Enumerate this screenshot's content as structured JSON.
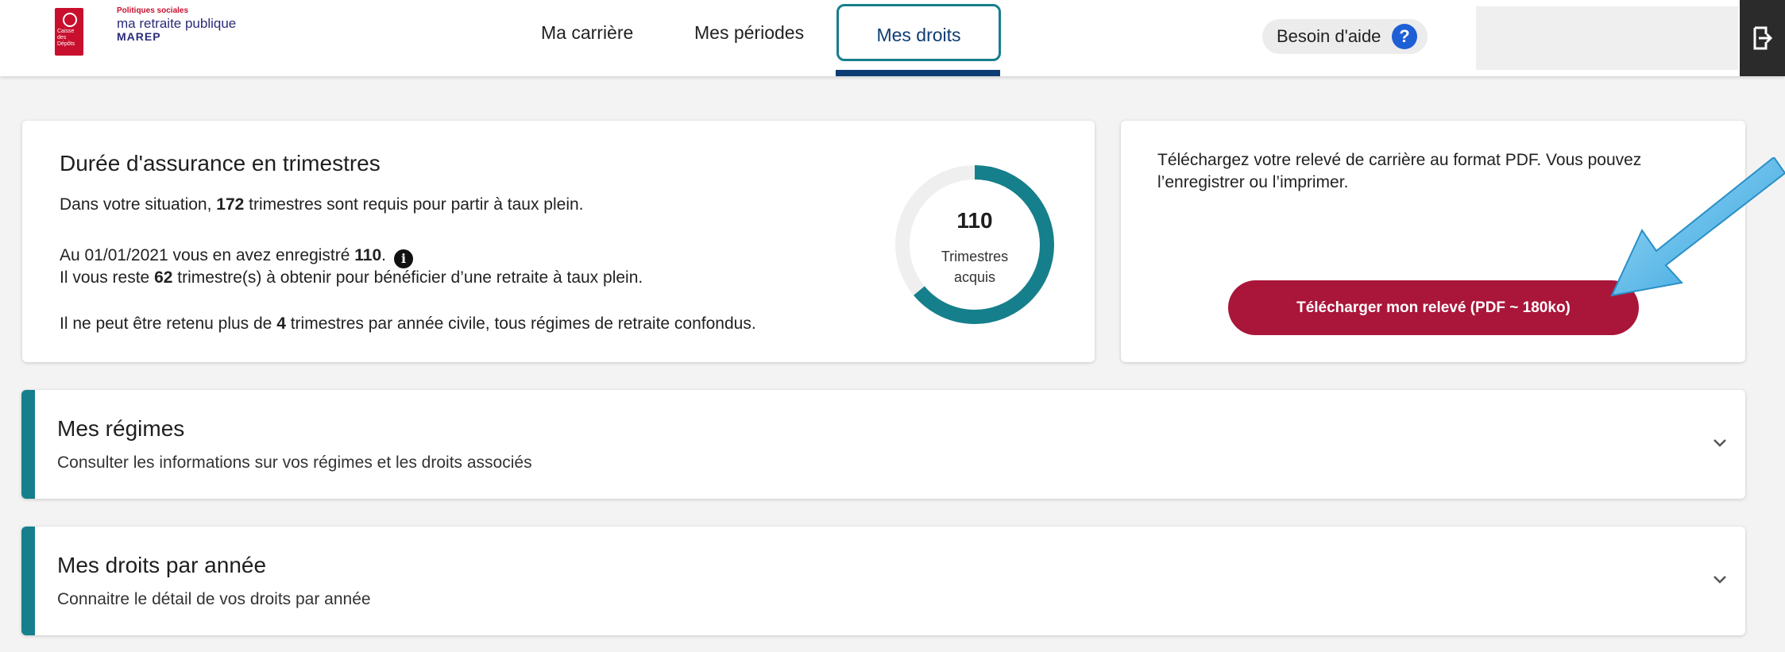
{
  "header": {
    "brand": {
      "badge_text": "Caisse des Dépôts",
      "kicker": "Politiques sociales",
      "name": "ma retraite publique",
      "product": "MAREP"
    },
    "nav": [
      {
        "label": "Ma carrière"
      },
      {
        "label": "Mes périodes"
      },
      {
        "label": "Mes droits",
        "active": true
      }
    ],
    "help_label": "Besoin d'aide",
    "help_icon": "?"
  },
  "insurance_card": {
    "title": "Durée d'assurance en trimestres",
    "line1_pre": "Dans votre situation, ",
    "line1_num": "172",
    "line1_post": " trimestres sont requis pour partir à taux plein.",
    "line2_pre": "Au 01/01/2021 vous en avez enregistré ",
    "line2_num": "110",
    "line2_post": ".",
    "line3_pre": "Il vous reste ",
    "line3_num": "62",
    "line3_post": " trimestre(s) à obtenir pour bénéficier d’une retraite à taux plein.",
    "line4_pre": "Il ne peut être retenu plus de ",
    "line4_num": "4",
    "line4_post": " trimestres par année civile, tous régimes de retraite confondus.",
    "gauge": {
      "value": "110",
      "label_line1": "Trimestres",
      "label_line2": "acquis",
      "acquired": 110,
      "required": 172,
      "color": "#167f8c",
      "track_color": "#efefef"
    }
  },
  "download_card": {
    "text_line1": "Téléchargez votre relevé de carrière au format PDF. Vous pouvez",
    "text_line2": "l’enregistrer ou l’imprimer.",
    "button_label": "Télécharger mon relevé (PDF ~ 180ko)"
  },
  "accordions": [
    {
      "title": "Mes régimes",
      "subtitle": "Consulter les informations sur vos régimes et les droits associés"
    },
    {
      "title": "Mes droits par année",
      "subtitle": "Connaitre le détail de vos droits par année"
    }
  ],
  "colors": {
    "accent": "#167f8c",
    "brand_red": "#c8102e",
    "button_red": "#a9163a",
    "nav_active": "#0d3d74",
    "help_blue": "#1f5fd6",
    "annotation_arrow": "#35a9e3"
  }
}
